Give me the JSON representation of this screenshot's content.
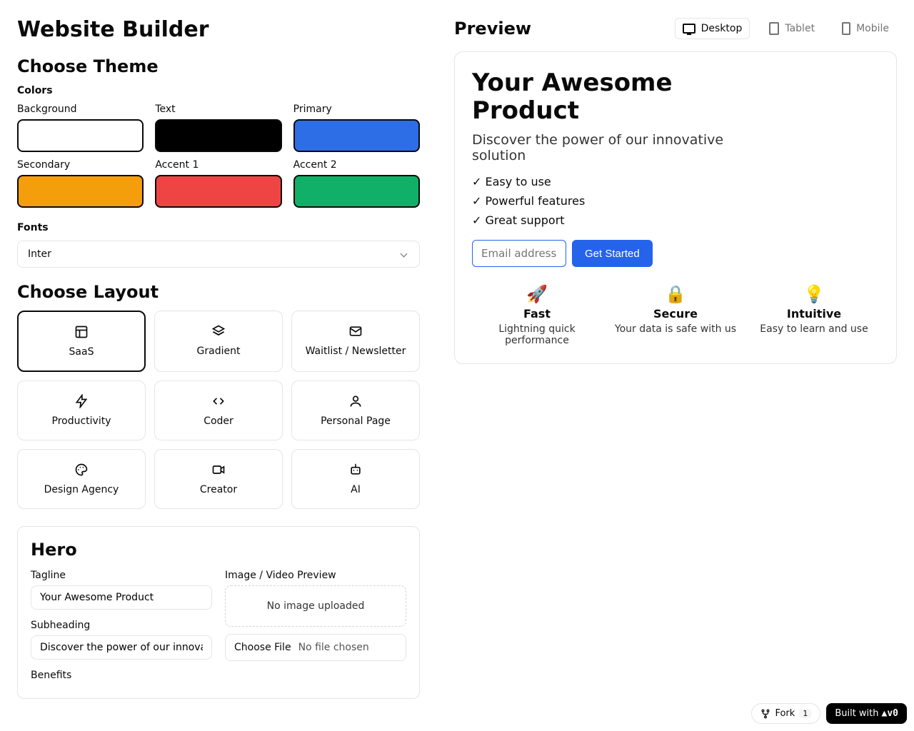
{
  "app": {
    "title": "Website Builder"
  },
  "theme": {
    "heading": "Choose Theme",
    "colors_label": "Colors",
    "colors": [
      {
        "name": "Background",
        "hex": "#ffffff"
      },
      {
        "name": "Text",
        "hex": "#000000"
      },
      {
        "name": "Primary",
        "hex": "#2d6ee6"
      },
      {
        "name": "Secondary",
        "hex": "#f59e0b"
      },
      {
        "name": "Accent 1",
        "hex": "#ef4444"
      },
      {
        "name": "Accent 2",
        "hex": "#10b069"
      }
    ],
    "fonts_label": "Fonts",
    "font_selected": "Inter"
  },
  "layout": {
    "heading": "Choose Layout",
    "options": [
      {
        "name": "SaaS",
        "icon": "layout-icon",
        "selected": true
      },
      {
        "name": "Gradient",
        "icon": "layers-icon",
        "selected": false
      },
      {
        "name": "Waitlist / Newsletter",
        "icon": "mail-icon",
        "selected": false
      },
      {
        "name": "Productivity",
        "icon": "zap-icon",
        "selected": false
      },
      {
        "name": "Coder",
        "icon": "code-icon",
        "selected": false
      },
      {
        "name": "Personal Page",
        "icon": "user-icon",
        "selected": false
      },
      {
        "name": "Design Agency",
        "icon": "palette-icon",
        "selected": false
      },
      {
        "name": "Creator",
        "icon": "video-icon",
        "selected": false
      },
      {
        "name": "AI",
        "icon": "bot-icon",
        "selected": false
      }
    ]
  },
  "hero": {
    "heading": "Hero",
    "tagline_label": "Tagline",
    "tagline_value": "Your Awesome Product",
    "subheading_label": "Subheading",
    "subheading_value": "Discover the power of our innovative solution",
    "benefits_label": "Benefits",
    "image_label": "Image / Video Preview",
    "image_status": "No image uploaded",
    "file_button": "Choose File",
    "file_status": "No file chosen"
  },
  "preview": {
    "title": "Preview",
    "devices": {
      "desktop": "Desktop",
      "tablet": "Tablet",
      "mobile": "Mobile",
      "active": "desktop"
    },
    "hero_title": "Your Awesome Product",
    "hero_sub": "Discover the power of our innovative solution",
    "benefits": [
      "Easy to use",
      "Powerful features",
      "Great support"
    ],
    "email_placeholder": "Email address",
    "cta": "Get Started",
    "features": [
      {
        "icon": "🚀",
        "title": "Fast",
        "desc": "Lightning quick performance"
      },
      {
        "icon": "🔒",
        "title": "Secure",
        "desc": "Your data is safe with us"
      },
      {
        "icon": "💡",
        "title": "Intuitive",
        "desc": "Easy to learn and use"
      }
    ]
  },
  "footer": {
    "fork_label": "Fork",
    "fork_count": "1",
    "built_with": "Built with",
    "built_brand": "v0"
  }
}
